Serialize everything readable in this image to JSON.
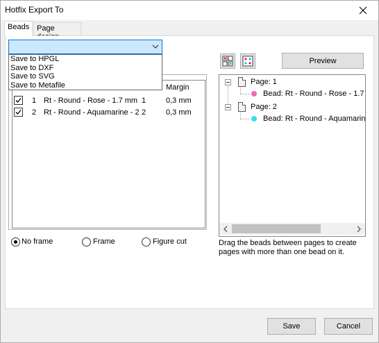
{
  "window": {
    "title": "Hotfix Export To",
    "close_glyph": "✕"
  },
  "tabs": [
    {
      "label": "Beads",
      "active": true
    },
    {
      "label": "Page design",
      "active": false
    }
  ],
  "combo": {
    "value": "",
    "options": [
      "Save to HPGL",
      "Save to DXF",
      "Save to SVG",
      "Save to Metafile"
    ]
  },
  "list": {
    "header_margin": "Margin",
    "rows": [
      {
        "checked": true,
        "num": "1",
        "name": "Rt - Round - Rose - 1.7 mm",
        "qty": "1",
        "margin": "0,3 mm"
      },
      {
        "checked": true,
        "num": "2",
        "name": "Rt - Round - Aquamarine - 2",
        "qty": "2",
        "margin": "0,3 mm"
      }
    ]
  },
  "frame_options": [
    {
      "label": "No frame",
      "selected": true
    },
    {
      "label": "Frame",
      "selected": false
    },
    {
      "label": "Figure cut",
      "selected": false
    }
  ],
  "toolbar": {
    "preview_label": "Preview"
  },
  "tree": {
    "pages": [
      {
        "label": "Page: 1",
        "bead": "Bead: Rt - Round - Rose - 1.7",
        "bead_color": "#f06ab0"
      },
      {
        "label": "Page: 2",
        "bead": "Bead: Rt - Round - Aquamarin",
        "bead_color": "#2ee0f0"
      }
    ]
  },
  "hint": "Drag the beads between pages to create pages with more than one bead on it.",
  "footer": {
    "save_label": "Save",
    "cancel_label": "Cancel"
  }
}
